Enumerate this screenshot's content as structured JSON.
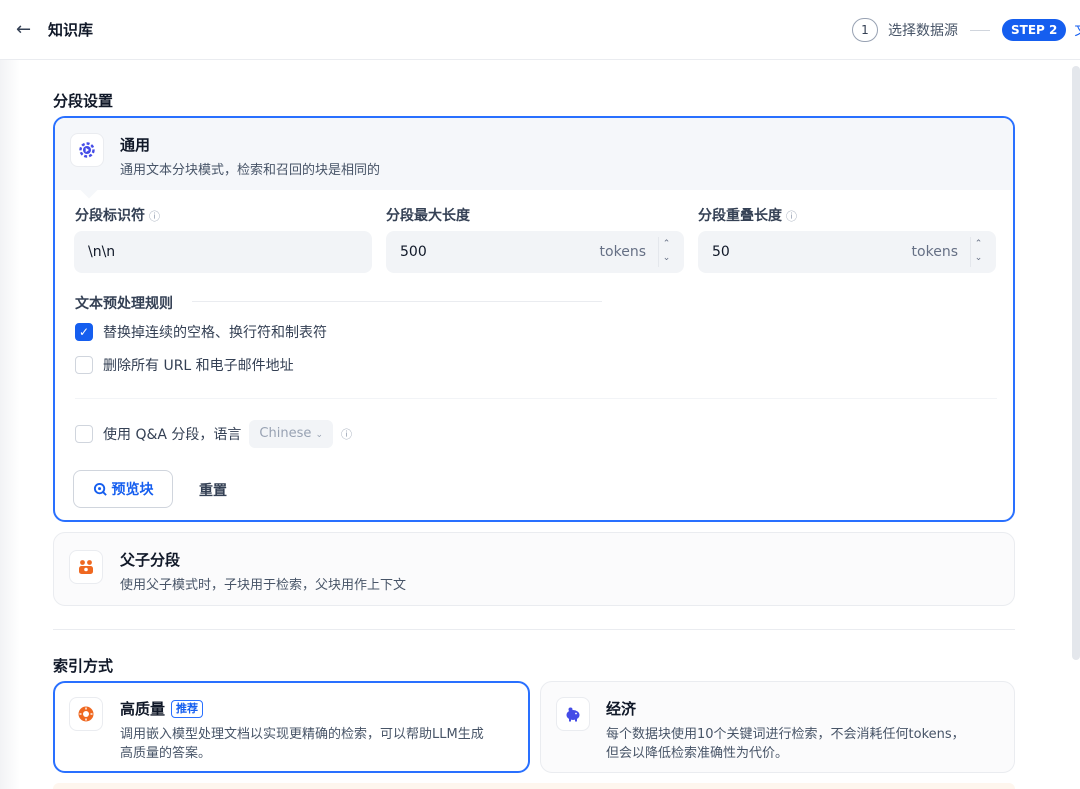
{
  "header": {
    "title": "知识库",
    "steps": [
      {
        "num": "1",
        "label": "选择数据源"
      },
      {
        "badge": "STEP 2",
        "label": "文"
      }
    ]
  },
  "segment": {
    "section_title": "分段设置",
    "general": {
      "title": "通用",
      "desc": "通用文本分块模式，检索和召回的块是相同的"
    },
    "fields": {
      "separator": {
        "label": "分段标识符",
        "value": "\\n\\n"
      },
      "max_length": {
        "label": "分段最大长度",
        "value": "500",
        "unit": "tokens"
      },
      "overlap": {
        "label": "分段重叠长度",
        "value": "50",
        "unit": "tokens"
      }
    },
    "preprocess": {
      "title": "文本预处理规则",
      "rule1": "替换掉连续的空格、换行符和制表符",
      "rule1_checked": true,
      "rule2": "删除所有 URL 和电子邮件地址",
      "rule2_checked": false
    },
    "qa": {
      "label": "使用 Q&A 分段，语言",
      "language": "Chinese"
    },
    "preview_btn": "预览块",
    "reset_btn": "重置",
    "parent": {
      "title": "父子分段",
      "desc": "使用父子模式时，子块用于检索，父块用作上下文"
    }
  },
  "index": {
    "section_title": "索引方式",
    "high_quality": {
      "title": "高质量",
      "badge": "推荐",
      "desc_line1": "调用嵌入模型处理文档以实现更精确的检索，可以帮助LLM生成",
      "desc_line2": "高质量的答案。"
    },
    "economy": {
      "title": "经济",
      "desc_line1": "每个数据块使用10个关键词进行检索，不会消耗任何tokens，",
      "desc_line2": "但会以降低检索准确性为代价。"
    }
  },
  "colors": {
    "accent": "#155eef",
    "border_active": "#2970ff"
  },
  "icons": [
    "back-arrow-icon",
    "gear-icon",
    "help-icon",
    "check-icon",
    "chevron-down-icon",
    "search-icon",
    "parent-child-icon",
    "sun-icon",
    "piggy-bank-icon"
  ]
}
